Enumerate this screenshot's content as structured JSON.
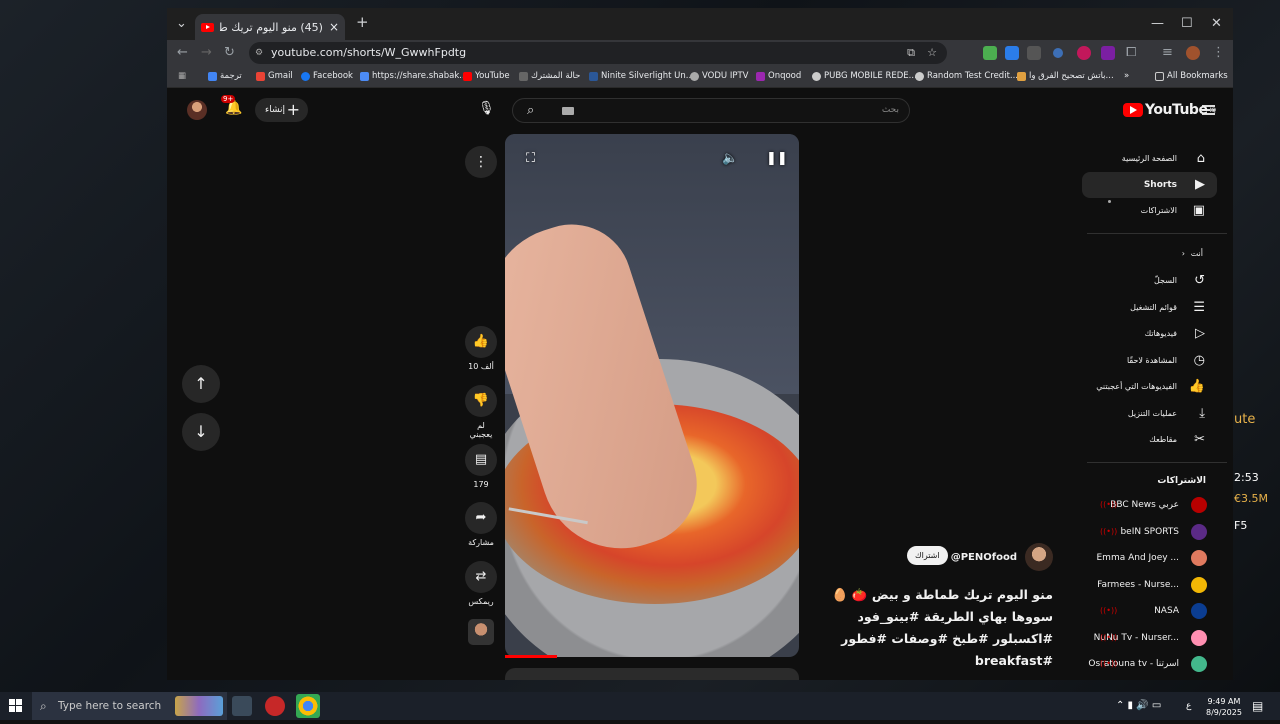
{
  "browser": {
    "tab_title": "(45) منو اليوم تريك طماطة و",
    "url": "youtube.com/shorts/W_GwwhFpdtg",
    "bookmarks": [
      "ترجمة",
      "Gmail",
      "Facebook",
      "https://share.shabak...",
      "YouTube",
      "حالة المشترك",
      "Ninite Silverlight Un...",
      "VODU IPTV",
      "Onqood",
      "PUBG MOBILE REDE...",
      "Random Test Credit...",
      "باتش تصحيح الفرق وا...",
      "All Bookmarks"
    ]
  },
  "youtube": {
    "logo_text": "YouTube",
    "logo_country": "IQ",
    "search_placeholder": "بحث",
    "create_label": "إنشاء",
    "notif_badge": "9+",
    "sidebar": {
      "home": "الصفحة الرئيسية",
      "shorts": "Shorts",
      "subscriptions": "الاشتراكات",
      "you": "أنت",
      "you_items": [
        "السجلّ",
        "قوائم التشغيل",
        "فيديوهاتك",
        "المشاهدة لاحقًا",
        "الفيديوهات التي أعجبتني",
        "عمليات التنزيل",
        "مقاطعك"
      ],
      "subs_heading": "الاشتراكات",
      "subs": [
        {
          "name": "BBC News عربي",
          "color": "#b80000"
        },
        {
          "name": "beIN SPORTS",
          "color": "#5b2a86"
        },
        {
          "name": "Emma And Joey ...",
          "color": "#e07a5f"
        },
        {
          "name": "Farmees - Nurse...",
          "color": "#f2b705"
        },
        {
          "name": "NASA",
          "color": "#0b3d91"
        },
        {
          "name": "NuNu Tv - Nurser...",
          "color": "#ff8fb1"
        },
        {
          "name": "Osratouna tv - اسرتنا",
          "color": "#43b88c"
        }
      ]
    },
    "short": {
      "likes": "10 ألف",
      "dislike_label": "لم يعجبني",
      "comments": "179",
      "share_label": "مشاركة",
      "remix_label": "ريمكس",
      "channel": "@PENOfood",
      "subscribe": "اشتراك",
      "caption": "منو اليوم تريك طماطة و بيض 🍅 🥚 سووها بهاي الطريقة #بينو_فود #اكسبلور #طبخ #وصفات #فطور #breakfast",
      "progress": 0.18
    }
  },
  "desktop": {
    "right_text": [
      "ute",
      "2:53",
      "€3.5M",
      "F5"
    ]
  },
  "taskbar": {
    "search_placeholder": "Type here to search",
    "time": "9:49 AM",
    "date": "8/9/2025",
    "lang": "ع"
  }
}
